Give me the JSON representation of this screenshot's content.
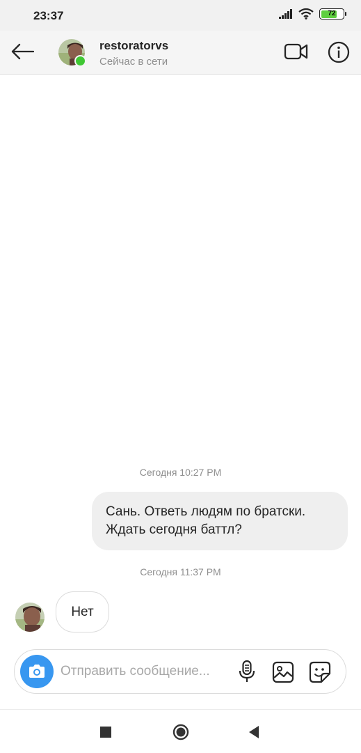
{
  "status_bar": {
    "time": "23:37",
    "battery": "72",
    "battery_level": 0.72,
    "icons": [
      "signal-icon",
      "wifi-icon",
      "battery-icon"
    ]
  },
  "header": {
    "username": "restoratorvs",
    "presence": "Сейчас в сети",
    "icons": [
      "back-arrow-icon",
      "video-call-icon",
      "info-icon"
    ]
  },
  "messages": [
    {
      "type": "timestamp",
      "text": "Сегодня 10:27 PM"
    },
    {
      "type": "outgoing",
      "lines": [
        "Сань. Ответь людям по братски.",
        "Ждать сегодня баттл?"
      ]
    },
    {
      "type": "timestamp",
      "text": "Сегодня 11:37 PM"
    },
    {
      "type": "incoming",
      "text": "Нет"
    }
  ],
  "composer": {
    "placeholder": "Отправить сообщение...",
    "value": "",
    "icons": [
      "camera-icon",
      "microphone-icon",
      "gallery-icon",
      "sticker-icon"
    ]
  },
  "nav_bar": {
    "icons": [
      "recents-icon",
      "home-icon",
      "back-icon"
    ]
  },
  "colors": {
    "accent": "#3897f0",
    "online": "#3fc733",
    "bubble_out": "#efefef",
    "battery": "#5fcf40"
  }
}
